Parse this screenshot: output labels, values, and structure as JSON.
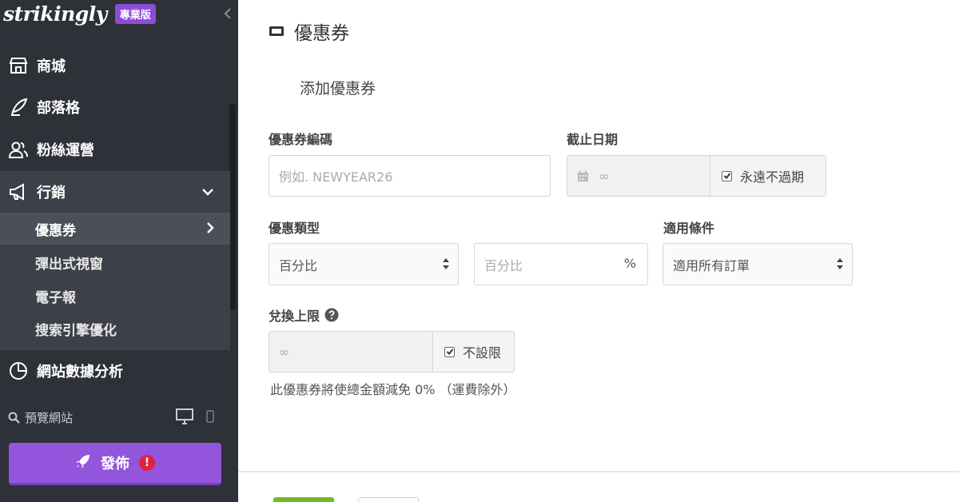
{
  "sidebar": {
    "logo": "strikingly",
    "badge": "專業版",
    "nav": {
      "store": "商城",
      "blog": "部落格",
      "fans": "粉絲運營",
      "marketing": "行銷",
      "analytics": "網站數據分析"
    },
    "submenu": {
      "coupons": "優惠券",
      "popup": "彈出式視窗",
      "newsletter": "電子報",
      "seo": "搜索引擎優化"
    },
    "preview": "預覽網站",
    "publish": "發佈",
    "publish_alert": "!"
  },
  "main": {
    "header": "優惠券",
    "section_title": "添加優惠券",
    "code": {
      "label": "優惠券編碼",
      "placeholder": "例如. NEWYEAR26"
    },
    "expiry": {
      "label": "截止日期",
      "value": "∞",
      "checkbox_label": "永遠不過期",
      "checked": true
    },
    "discount": {
      "label": "優惠類型",
      "type_value": "百分比",
      "amount_placeholder": "百分比",
      "suffix": "%"
    },
    "condition": {
      "label": "適用條件",
      "value": "適用所有訂單"
    },
    "limit": {
      "label": "兌換上限",
      "value": "∞",
      "checkbox_label": "不設限",
      "checked": true
    },
    "help_text": "此優惠券將使總金額減免 0% （運費除外）"
  },
  "colors": {
    "sidebar_bg": "#2e3138",
    "sidebar_active": "#3d4048",
    "publish": "#9355dc",
    "badge": "#8e4bd8",
    "save": "#76b82a",
    "alert": "#e0223e"
  },
  "icons": {
    "store": "store-icon",
    "blog": "quill-icon",
    "fans": "users-icon",
    "marketing": "megaphone-icon",
    "analytics": "pie-chart-icon",
    "coupon": "ticket-icon",
    "calendar": "calendar-icon",
    "help": "question-circle-icon",
    "rocket": "rocket-icon"
  }
}
